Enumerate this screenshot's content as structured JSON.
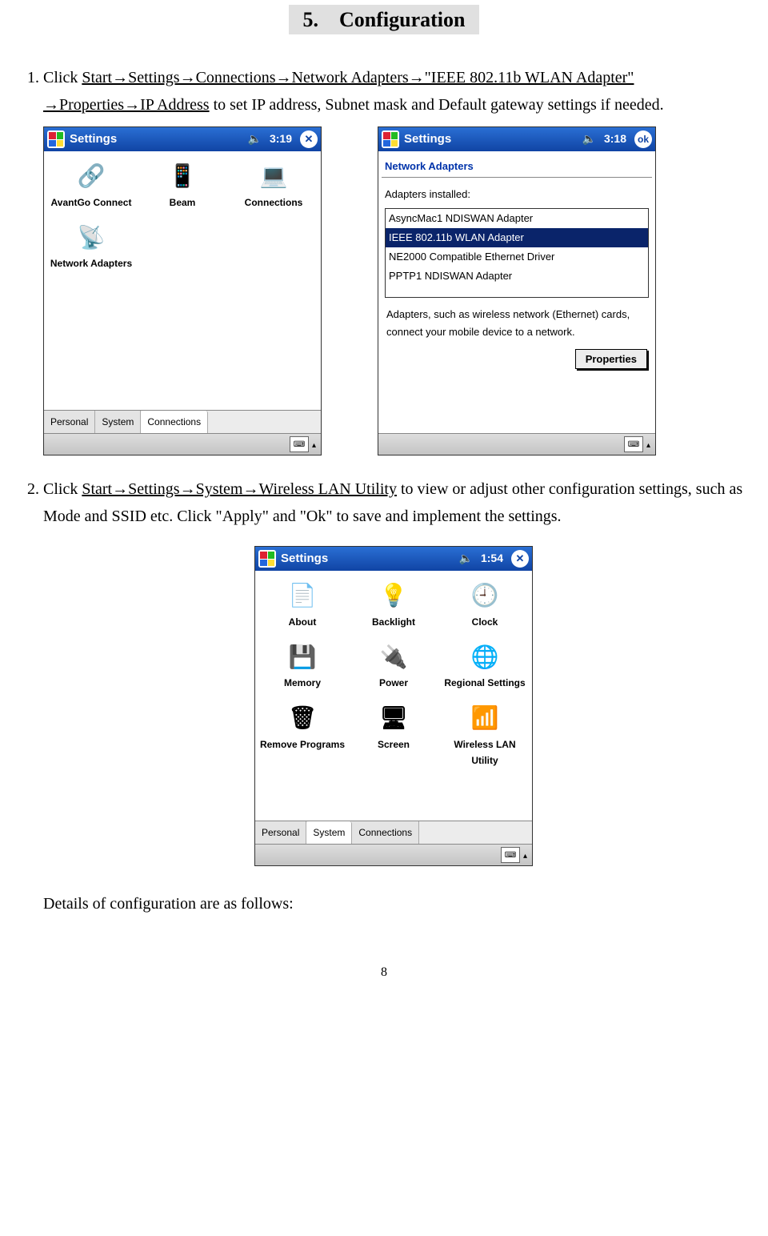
{
  "section": {
    "number": "5.",
    "title": "Configuration"
  },
  "step1": {
    "lead": "Click",
    "path": " Start→Settings→Connections→Network Adapters→\"IEEE 802.11b WLAN Adapter\"",
    "path2": "→Properties→IP Address",
    "tail": " to set IP address, Subnet mask and Default gateway settings if needed."
  },
  "step2": {
    "lead": "Click ",
    "path": "Start→Settings→System→Wireless LAN Utility",
    "tail": " to view or adjust other configuration settings, such as Mode and SSID etc.    Click \"Apply\" and \"Ok\" to save and implement the settings."
  },
  "details": "Details of configuration are as follows:",
  "page_num": "8",
  "shot_conn": {
    "title": "Settings",
    "time": "3:19",
    "icons": [
      {
        "cls": "ic-avantgo",
        "label": "AvantGo Connect"
      },
      {
        "cls": "ic-beam",
        "label": "Beam"
      },
      {
        "cls": "ic-conn",
        "label": "Connections"
      },
      {
        "cls": "ic-netadapt",
        "label": "Network Adapters"
      }
    ],
    "tabs": [
      "Personal",
      "System",
      "Connections"
    ],
    "active_tab": 2,
    "close": "✕"
  },
  "shot_na": {
    "title": "Settings",
    "time": "3:18",
    "ok": "ok",
    "heading": "Network Adapters",
    "label": "Adapters installed:",
    "list": [
      {
        "t": "AsyncMac1 NDISWAN Adapter",
        "sel": false
      },
      {
        "t": "IEEE 802.11b WLAN Adapter",
        "sel": true
      },
      {
        "t": "NE2000 Compatible Ethernet Driver",
        "sel": false
      },
      {
        "t": "PPTP1 NDISWAN Adapter",
        "sel": false
      }
    ],
    "desc": "Adapters, such as wireless network (Ethernet) cards, connect your mobile device to a network.",
    "props_btn": "Properties"
  },
  "shot_sys": {
    "title": "Settings",
    "time": "1:54",
    "close": "✕",
    "icons": [
      {
        "cls": "ic-about",
        "label": "About"
      },
      {
        "cls": "ic-backlight",
        "label": "Backlight"
      },
      {
        "cls": "ic-clock",
        "label": "Clock"
      },
      {
        "cls": "ic-memory",
        "label": "Memory"
      },
      {
        "cls": "ic-power",
        "label": "Power"
      },
      {
        "cls": "ic-regional",
        "label": "Regional Settings"
      },
      {
        "cls": "ic-remove",
        "label": "Remove Programs"
      },
      {
        "cls": "ic-screen",
        "label": "Screen"
      },
      {
        "cls": "ic-wlan",
        "label": "Wireless LAN Utility"
      }
    ],
    "tabs": [
      "Personal",
      "System",
      "Connections"
    ],
    "active_tab": 1
  }
}
